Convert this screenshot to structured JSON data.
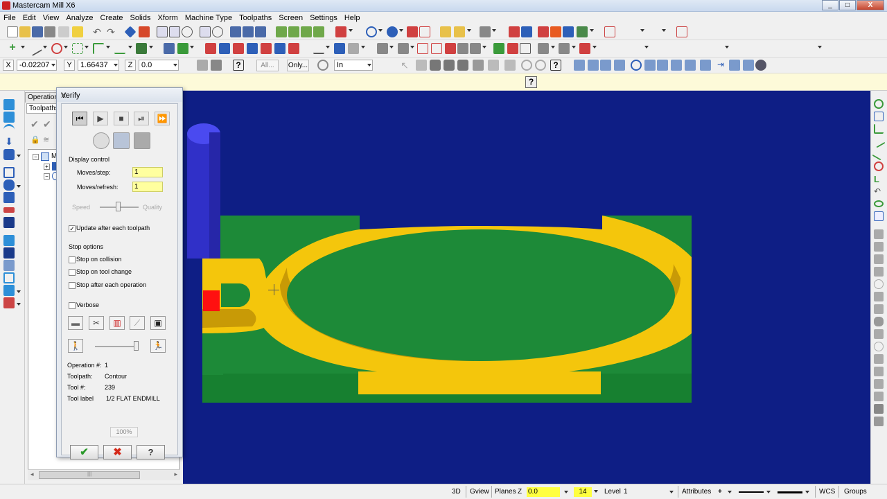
{
  "window": {
    "title": "Mastercam Mill X6",
    "min": "_",
    "max": "□",
    "close": "X"
  },
  "menu": [
    "File",
    "Edit",
    "View",
    "Analyze",
    "Create",
    "Solids",
    "Xform",
    "Machine Type",
    "Toolpaths",
    "Screen",
    "Settings",
    "Help"
  ],
  "coords": {
    "x_label": "X",
    "x_value": "-0.02207",
    "y_label": "Y",
    "y_value": "1.66437",
    "z_label": "Z",
    "z_value": "0.0",
    "all_btn": "All...",
    "only_btn": "Only...",
    "units_value": "In"
  },
  "prompt": {
    "help_icon": "?"
  },
  "ops_panel": {
    "tab_operations": "Operations",
    "tab_toolpaths": "Toolpaths",
    "tree_root": "M"
  },
  "verify": {
    "title": "Verify",
    "close": "X",
    "display_control": "Display control",
    "moves_step_label": "Moves/step:",
    "moves_step_value": "1",
    "moves_refresh_label": "Moves/refresh:",
    "moves_refresh_value": "1",
    "speed_label": "Speed",
    "quality_label": "Quality",
    "update_label": "Update after each toolpath",
    "update_checked": true,
    "stop_options": "Stop options",
    "stop_collision": "Stop on collision",
    "stop_tool_change": "Stop on tool change",
    "stop_after_op": "Stop after each operation",
    "verbose": "Verbose",
    "operation_label": "Operation #:",
    "operation_value": "1",
    "toolpath_label": "Toolpath:",
    "toolpath_value": "Contour",
    "tool_num_label": "Tool #:",
    "tool_num_value": "239",
    "tool_label_label": "Tool label",
    "tool_label_value": "1/2 FLAT ENDMILL",
    "percent": "100%",
    "ok": "✔",
    "cancel": "✖",
    "help": "?"
  },
  "status": {
    "view_3d": "3D",
    "gview": "Gview",
    "planes": "Planes",
    "z_label": "Z",
    "z_value": "0.0",
    "color_value": "14",
    "level_label": "Level",
    "level_value": "1",
    "attributes": "Attributes",
    "wcs": "WCS",
    "groups": "Groups"
  },
  "colors": {
    "viewport_bg": "#0e1e85",
    "stock_green": "#1c8838",
    "cut_yellow": "#f2c30a",
    "tool_blue": "#3a3ad6",
    "collision_red": "#ff1010",
    "prompt_bg": "#fdfad9",
    "input_yellow": "#ffff9f"
  }
}
